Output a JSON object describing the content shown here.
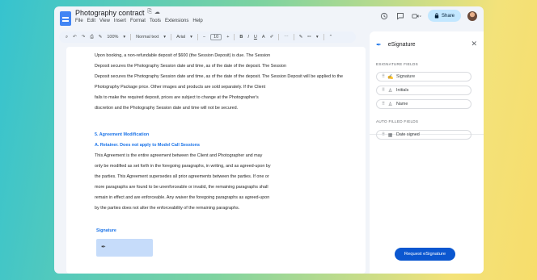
{
  "app": {
    "title": "Photography contract",
    "title_icons": [
      "☆",
      "⎘",
      "☁"
    ],
    "menu": [
      "File",
      "Edit",
      "View",
      "Insert",
      "Format",
      "Tools",
      "Extensions",
      "Help"
    ],
    "share_label": "Share"
  },
  "toolbar": {
    "zoom": "100%",
    "style": "Normal text",
    "font": "Arial",
    "font_size": "10"
  },
  "document": {
    "lines": [
      "Upon booking, a non-refundable deposit of $600 (the Session Deposit) is due. The Session",
      "Deposit secures the Photography Session date and time, as of the date of the deposit. The Session",
      "Deposit secures the Photography Session date and time, as of the date of the deposit. The Session Deposit will be applied to the",
      "Photography Package price. Other images and products are sold separately. If the Client",
      "fails to make the required deposit, prices are subject to change at the Photographer's",
      "discretion and the Photography Session date and time will not be secured."
    ],
    "section_heading": "5. Agreement Modification",
    "subheading": "A. Retainer.  Does not apply to Model Call Sessions",
    "body_lines": [
      "This Agreement is the entire agreement between the Client and Photographer and may",
      "only be modified as set forth in the foregoing paragraphs, in writing, and as agreed-upon by",
      "the parties.  This Agreement supersedes all prior agreements between the parties. If one or",
      "more paragraphs are found to be unenforceable or invalid, the remaining paragraphs shall",
      "remain in effect and are enforceable. Any waiver the foregoing paragraphs as agreed-upon",
      "by the parties does not alter the enforceability of the remaining paragraphs."
    ],
    "signature_label": "Signature"
  },
  "panel": {
    "title": "eSignature",
    "esign_section": "ESIGNATURE FIELDS",
    "esign_fields": [
      "Signature",
      "Initials",
      "Name"
    ],
    "auto_section": "AUTO FILLED FIELDS",
    "auto_fields": [
      "Date signed"
    ],
    "request_label": "Request eSignature"
  }
}
